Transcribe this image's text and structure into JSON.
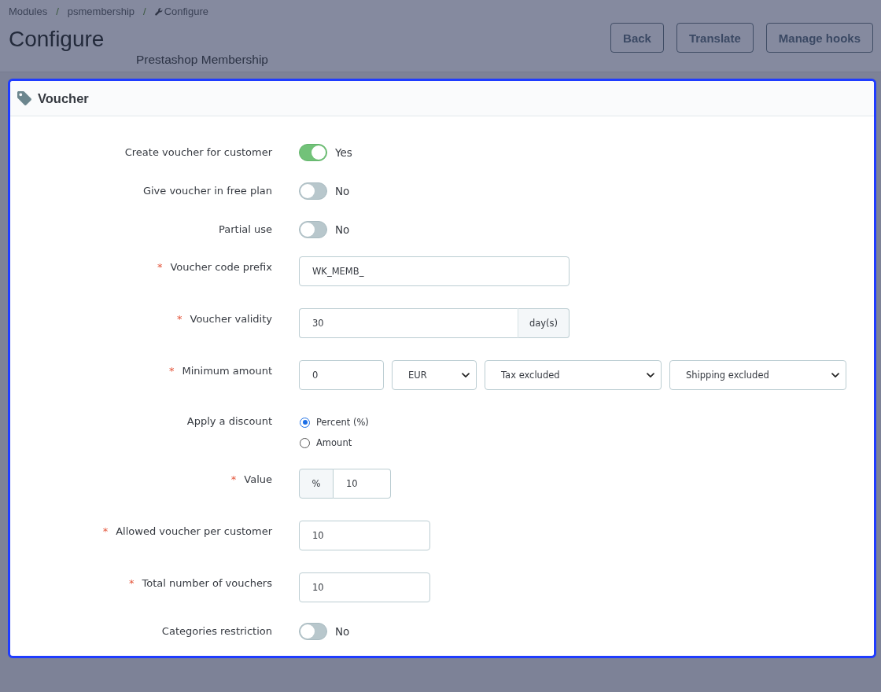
{
  "breadcrumb": [
    {
      "kind": "link",
      "label": "Modules"
    },
    {
      "kind": "separator",
      "label": "/"
    },
    {
      "kind": "link",
      "label": "psmembership"
    },
    {
      "kind": "separator",
      "label": "/"
    },
    {
      "kind": "current",
      "label": "Configure"
    }
  ],
  "page": {
    "title": "Configure",
    "subtitle": "Prestashop Membership",
    "buttons": [
      "Back",
      "Translate",
      "Manage hooks"
    ]
  },
  "panel": {
    "title": "Voucher",
    "highlighted": true,
    "fields": [
      {
        "kind": "switch",
        "label": "Create voucher for customer",
        "on": true,
        "state_text": "Yes"
      },
      {
        "kind": "switch",
        "label": "Give voucher in free plan",
        "on": false,
        "state_text": "No"
      },
      {
        "kind": "switch",
        "label": "Partial use",
        "on": false,
        "state_text": "No"
      },
      {
        "kind": "text",
        "required_mark": "*",
        "label": "Voucher code prefix",
        "value": "WK_MEMB_"
      },
      {
        "kind": "suffixed",
        "required_mark": "*",
        "label": "Voucher validity",
        "value": "30",
        "suffix": "day(s)"
      },
      {
        "kind": "amount",
        "required_mark": "*",
        "label": "Minimum amount",
        "value": "0",
        "selects": [
          "EUR",
          "Tax excluded",
          "Shipping excluded"
        ]
      },
      {
        "kind": "radio",
        "label": "Apply a discount",
        "options": [
          {
            "label": "Percent (%)",
            "selected": true
          },
          {
            "label": "Amount",
            "selected": false
          }
        ]
      },
      {
        "kind": "prefixed",
        "required_mark": "*",
        "label": "Value",
        "prefix": "%",
        "value": "10"
      },
      {
        "kind": "number",
        "required_mark": "*",
        "label": "Allowed voucher per customer",
        "value": "10"
      },
      {
        "kind": "number",
        "required_mark": "*",
        "label": "Total number of vouchers",
        "value": "10"
      },
      {
        "kind": "switch",
        "label": "Categories restriction",
        "on": false,
        "state_text": "No"
      }
    ]
  }
}
